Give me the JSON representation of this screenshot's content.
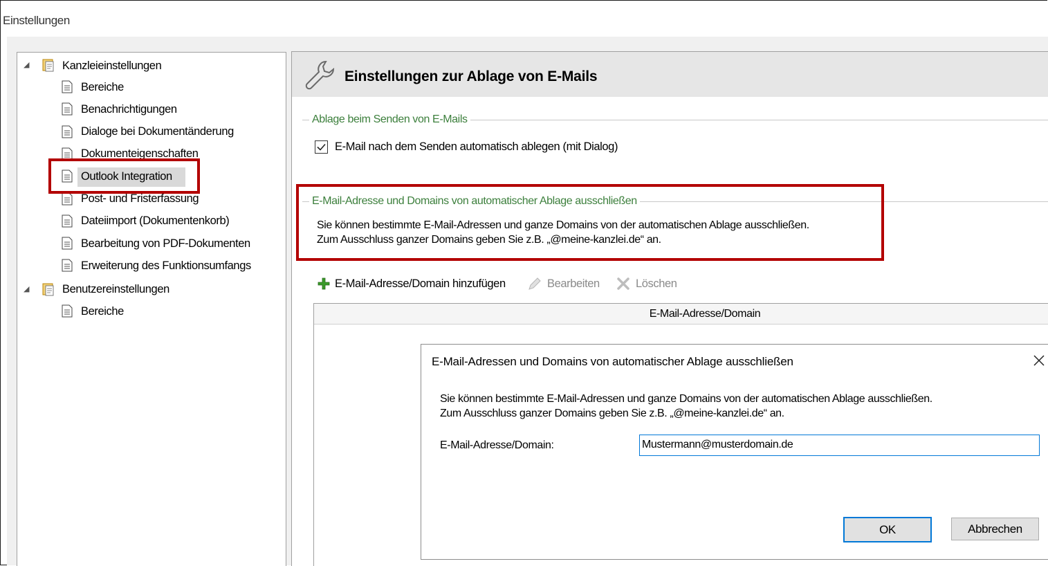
{
  "window": {
    "title": "Einstellungen"
  },
  "tree": {
    "groups": [
      {
        "label": "Kanzleieinstellungen",
        "items": [
          "Bereiche",
          "Benachrichtigungen",
          "Dialoge bei Dokumentänderung",
          "Dokumenteigenschaften",
          "Outlook Integration",
          "Post- und Fristerfassung",
          "Dateiimport (Dokumentenkorb)",
          "Bearbeitung von PDF-Dokumenten",
          "Erweiterung des Funktionsumfangs"
        ]
      },
      {
        "label": "Benutzereinstellungen",
        "items": [
          "Bereiche"
        ]
      }
    ],
    "selected": "Outlook Integration"
  },
  "main": {
    "header_title": "Einstellungen zur Ablage von E-Mails",
    "group1": {
      "caption": "Ablage beim Senden von E-Mails",
      "checkbox_label": "E-Mail nach dem Senden automatisch ablegen (mit Dialog)",
      "checked": true
    },
    "group2": {
      "caption": "E-Mail-Adresse und Domains von automatischer Ablage ausschließen",
      "line1": "Sie können bestimmte E-Mail-Adressen und ganze Domains von der automatischen Ablage ausschließen.",
      "line2": "Zum Ausschluss ganzer Domains geben Sie z.B. „@meine-kanzlei.de“ an."
    },
    "toolbar": {
      "add_label": "E-Mail-Adresse/Domain hinzufügen",
      "edit_label": "Bearbeiten",
      "delete_label": "Löschen"
    },
    "table": {
      "column_header": "E-Mail-Adresse/Domain"
    }
  },
  "dialog": {
    "title": "E-Mail-Adressen und Domains von automatischer Ablage ausschließen",
    "line1": "Sie können bestimmte E-Mail-Adressen und ganze Domains von der automatischen Ablage ausschließen.",
    "line2": "Zum Ausschluss ganzer Domains geben Sie z.B. „@meine-kanzlei.de“ an.",
    "field_label": "E-Mail-Adresse/Domain:",
    "field_value": "Mustermann@musterdomain.de",
    "ok_label": "OK",
    "cancel_label": "Abbrechen"
  },
  "colors": {
    "highlight": "#b30000",
    "group_caption": "#3c7f3c",
    "add_icon": "#3a9a2a",
    "focus_border": "#0078d7"
  }
}
